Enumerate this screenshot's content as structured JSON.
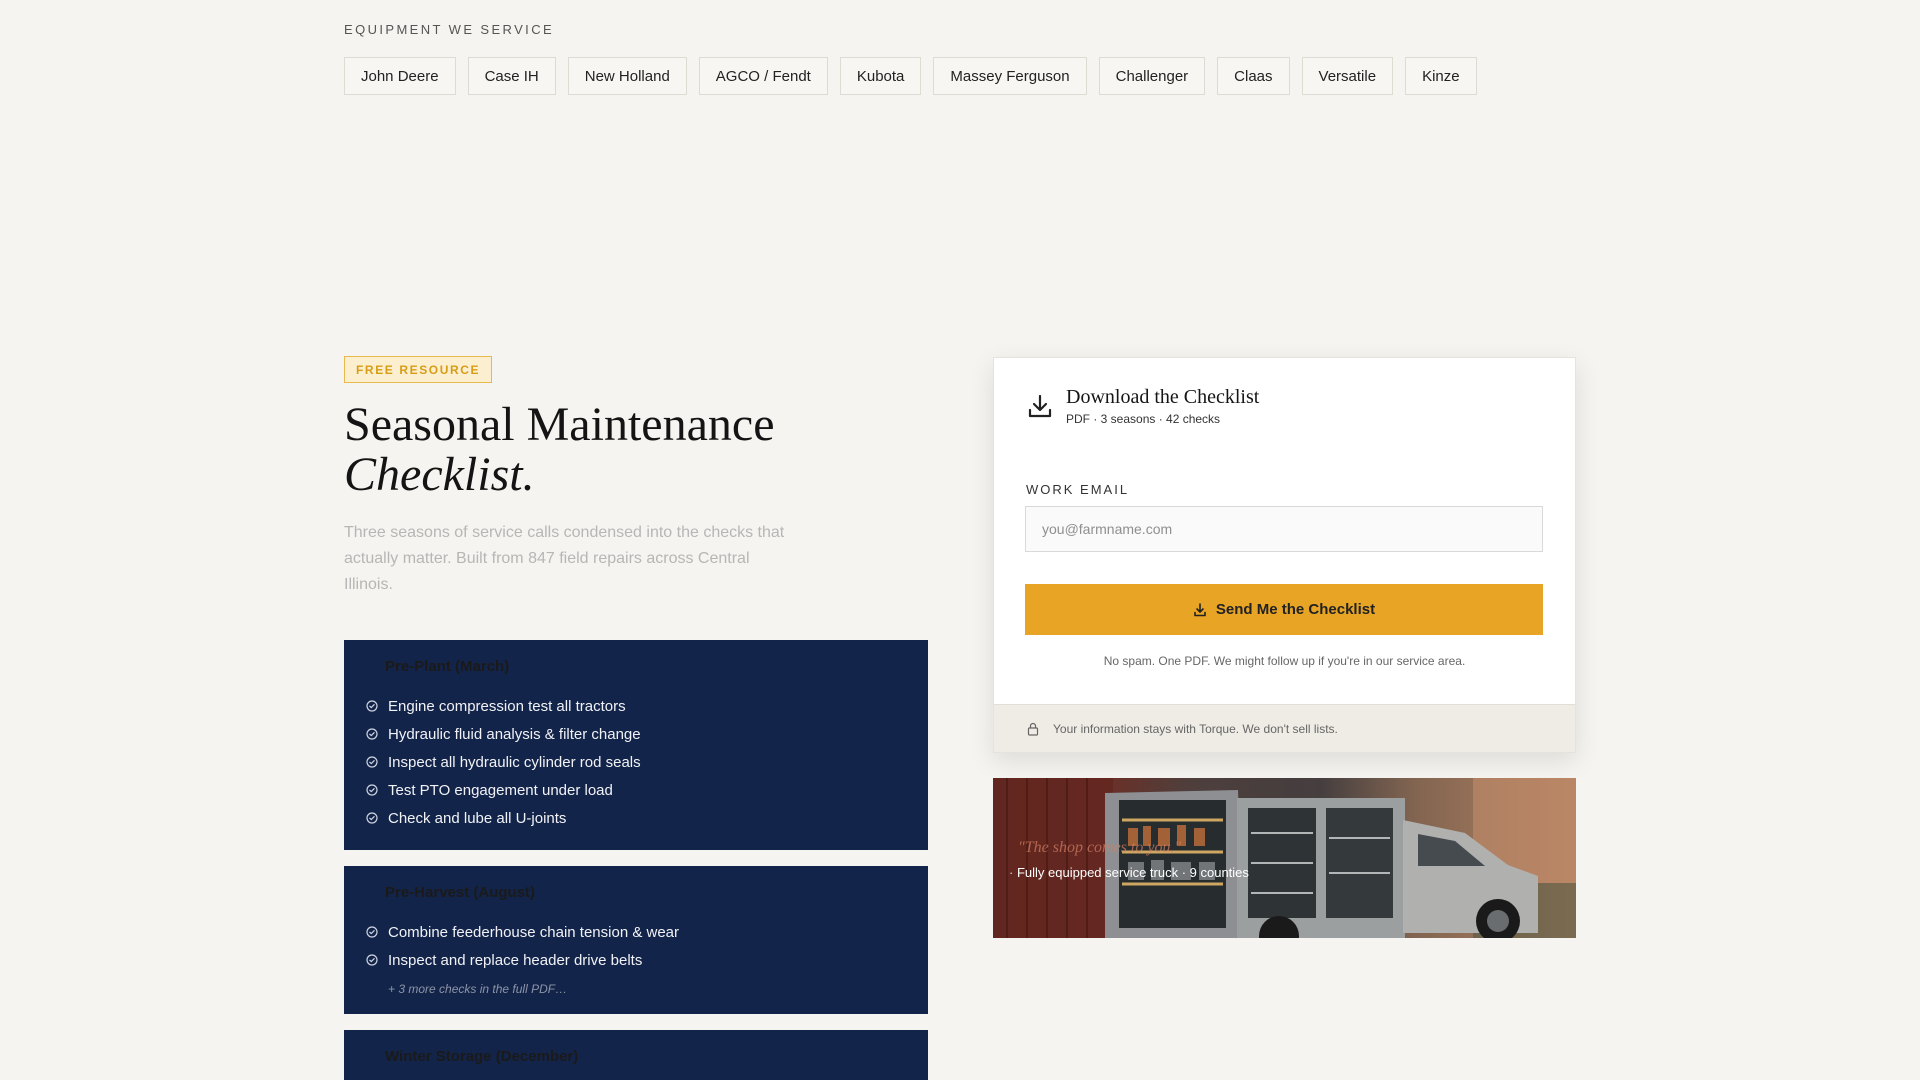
{
  "equipment": {
    "label": "EQUIPMENT WE SERVICE",
    "brands": [
      "John Deere",
      "Case IH",
      "New Holland",
      "AGCO / Fendt",
      "Kubota",
      "Massey Ferguson",
      "Challenger",
      "Claas",
      "Versatile",
      "Kinze"
    ]
  },
  "resource": {
    "badge": "FREE RESOURCE",
    "title_line1": "Seasonal Maintenance",
    "title_line2": "Checklist.",
    "intro": "Three seasons of service calls condensed into the checks that actually matter. Built from 847 field repairs across Central Illinois."
  },
  "seasons": [
    {
      "title": "Pre-Plant (March)",
      "checks": [
        "Engine compression test all tractors",
        "Hydraulic fluid analysis & filter change",
        "Inspect all hydraulic cylinder rod seals",
        "Test PTO engagement under load",
        "Check and lube all U-joints"
      ]
    },
    {
      "title": "Pre-Harvest (August)",
      "checks": [
        "Combine feederhouse chain tension & wear",
        "Inspect and replace header drive belts"
      ],
      "more": "+ 3 more checks in the full PDF…"
    },
    {
      "title": "Winter Storage (December)"
    }
  ],
  "download": {
    "title": "Download the Checklist",
    "meta": "PDF · 3 seasons · 42 checks",
    "email_label": "WORK EMAIL",
    "email_placeholder": "you@farmname.com",
    "button_label": "Send Me the Checklist",
    "disclaimer": "No spam. One PDF. We might follow up if you're in our service area.",
    "privacy": "Your information stays with Torque. We don't sell lists.",
    "accent_color": "#e8a425"
  },
  "photo": {
    "quote": "\"The shop comes to you.\"",
    "caption": "Fully equipped service truck · 9 counties"
  }
}
